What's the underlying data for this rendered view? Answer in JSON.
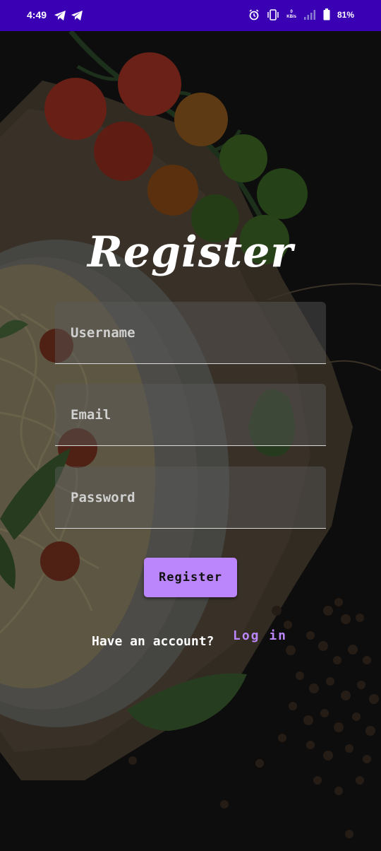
{
  "status_bar": {
    "time": "4:49",
    "speed_value": "0",
    "speed_unit": "KB/s",
    "battery": "81%"
  },
  "form": {
    "title": "Register",
    "username_placeholder": "Username",
    "email_placeholder": "Email",
    "password_placeholder": "Password",
    "register_button": "Register"
  },
  "footer": {
    "have_account": "Have an account?",
    "login_link": "Log in"
  },
  "colors": {
    "status_bar": "#3a00b4",
    "accent": "#bb86fc",
    "background": "#141414"
  },
  "icons": [
    "telegram-icon",
    "telegram-icon",
    "alarm-icon",
    "vibrate-icon",
    "signal-icon",
    "battery-icon"
  ]
}
